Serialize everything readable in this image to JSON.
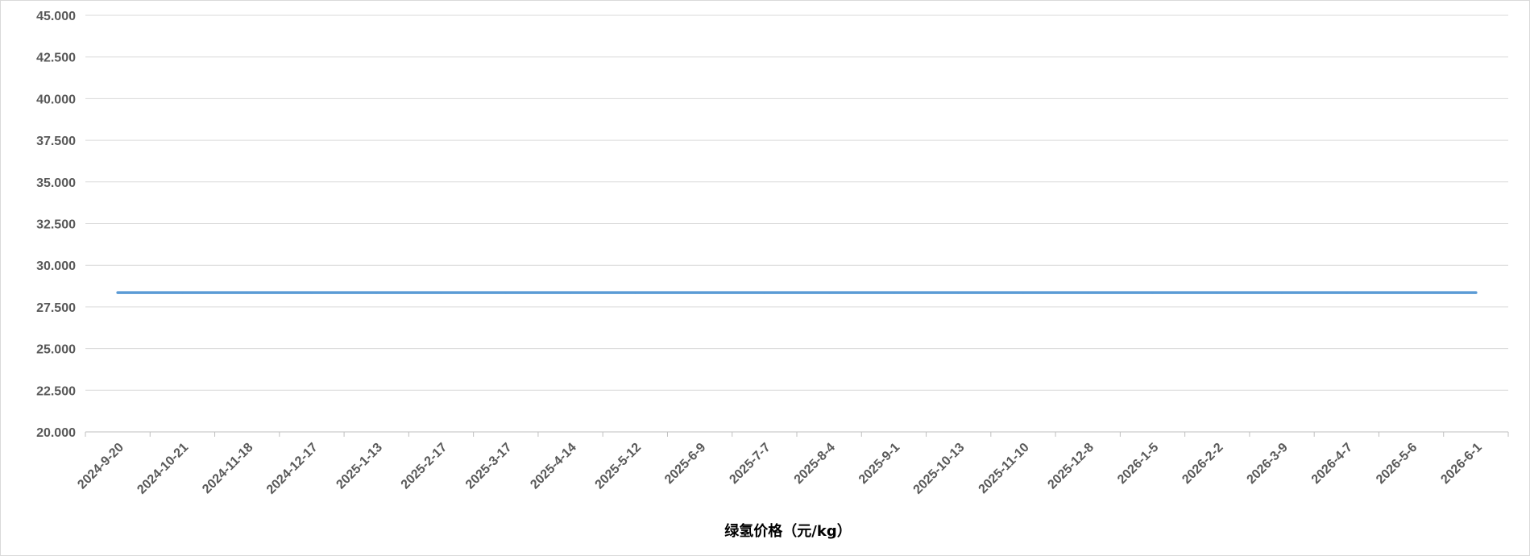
{
  "chart_data": {
    "type": "line",
    "title": "",
    "xlabel": "绿氢价格（元/kg）",
    "ylabel": "",
    "ylim": [
      20,
      45
    ],
    "y_ticks": [
      "20.000",
      "22.500",
      "25.000",
      "27.500",
      "30.000",
      "32.500",
      "35.000",
      "37.500",
      "40.000",
      "42.500",
      "45.000"
    ],
    "categories": [
      "2024-9-20",
      "2024-10-21",
      "2024-11-18",
      "2024-12-17",
      "2025-1-13",
      "2025-2-17",
      "2025-3-17",
      "2025-4-14",
      "2025-5-12",
      "2025-6-9",
      "2025-7-7",
      "2025-8-4",
      "2025-9-1",
      "2025-10-13",
      "2025-11-10",
      "2025-12-8",
      "2026-1-5",
      "2026-2-2",
      "2026-3-9",
      "2026-4-7",
      "2026-5-6",
      "2026-6-1"
    ],
    "series": [
      {
        "values": [
          28.36,
          28.36,
          28.36,
          28.36,
          28.36,
          28.36,
          28.36,
          28.36,
          28.36,
          28.36,
          28.36,
          28.36,
          28.36,
          28.36,
          28.36,
          28.36,
          28.36,
          28.36,
          28.36,
          28.36,
          28.36,
          28.36
        ],
        "color": "#5b9bd5"
      }
    ],
    "grid": true,
    "legend": "none",
    "colors": {
      "line": "#5b9bd5",
      "grid": "#d9d9d9",
      "axis": "#bfbfbf",
      "tick_text": "#595959"
    }
  }
}
